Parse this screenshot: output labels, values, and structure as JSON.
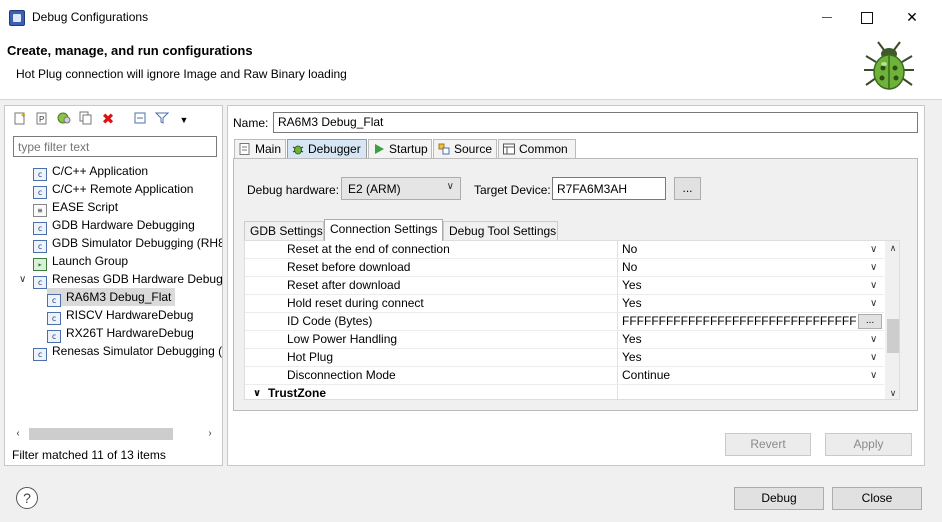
{
  "window": {
    "title": "Debug Configurations"
  },
  "header": {
    "title": "Create, manage, and run configurations",
    "message": "Hot Plug connection will ignore Image and Raw Binary loading"
  },
  "left_panel": {
    "filter_placeholder": "type filter text",
    "tree": [
      {
        "label": "C/C++ Application",
        "icon": "c-launch-icon"
      },
      {
        "label": "C/C++ Remote Application",
        "icon": "c-launch-icon"
      },
      {
        "label": "EASE Script",
        "icon": "script-icon"
      },
      {
        "label": "GDB Hardware Debugging",
        "icon": "c-launch-icon"
      },
      {
        "label": "GDB Simulator Debugging (RH8",
        "icon": "c-launch-icon"
      },
      {
        "label": "Launch Group",
        "icon": "launch-group-icon"
      },
      {
        "label": "Renesas GDB Hardware Debugg",
        "icon": "c-launch-icon",
        "expanded": true
      },
      {
        "label": "RA6M3 Debug_Flat",
        "icon": "c-launch-icon",
        "selected": true
      },
      {
        "label": "RISCV HardwareDebug",
        "icon": "c-launch-icon"
      },
      {
        "label": "RX26T HardwareDebug",
        "icon": "c-launch-icon"
      },
      {
        "label": "Renesas Simulator Debugging (",
        "icon": "c-launch-icon"
      }
    ],
    "status": "Filter matched 11 of 13 items"
  },
  "right_panel": {
    "name_label": "Name:",
    "name_value": "RA6M3 Debug_Flat",
    "tabs": [
      "Main",
      "Debugger",
      "Startup",
      "Source",
      "Common"
    ],
    "active_tab": "Debugger",
    "debug_hardware_label": "Debug hardware:",
    "debug_hardware_value": "E2 (ARM)",
    "target_device_label": "Target Device:",
    "target_device_value": "R7FA6M3AH",
    "browse_button": "...",
    "subtabs": [
      "GDB Settings",
      "Connection Settings",
      "Debug Tool Settings"
    ],
    "active_subtab": "Connection Settings",
    "properties": [
      {
        "key": "Reset at the end of connection",
        "value": "No"
      },
      {
        "key": "Reset before download",
        "value": "No"
      },
      {
        "key": "Reset after download",
        "value": "Yes"
      },
      {
        "key": "Hold reset during connect",
        "value": "Yes"
      },
      {
        "key": "ID Code (Bytes)",
        "value": "FFFFFFFFFFFFFFFFFFFFFFFFFFFFFFFF"
      },
      {
        "key": "Low Power Handling",
        "value": "Yes"
      },
      {
        "key": "Hot Plug",
        "value": "Yes"
      },
      {
        "key": "Disconnection Mode",
        "value": "Continue"
      }
    ],
    "section": "TrustZone",
    "revert_button": "Revert",
    "apply_button": "Apply"
  },
  "footer": {
    "debug_button": "Debug",
    "close_button": "Close"
  }
}
